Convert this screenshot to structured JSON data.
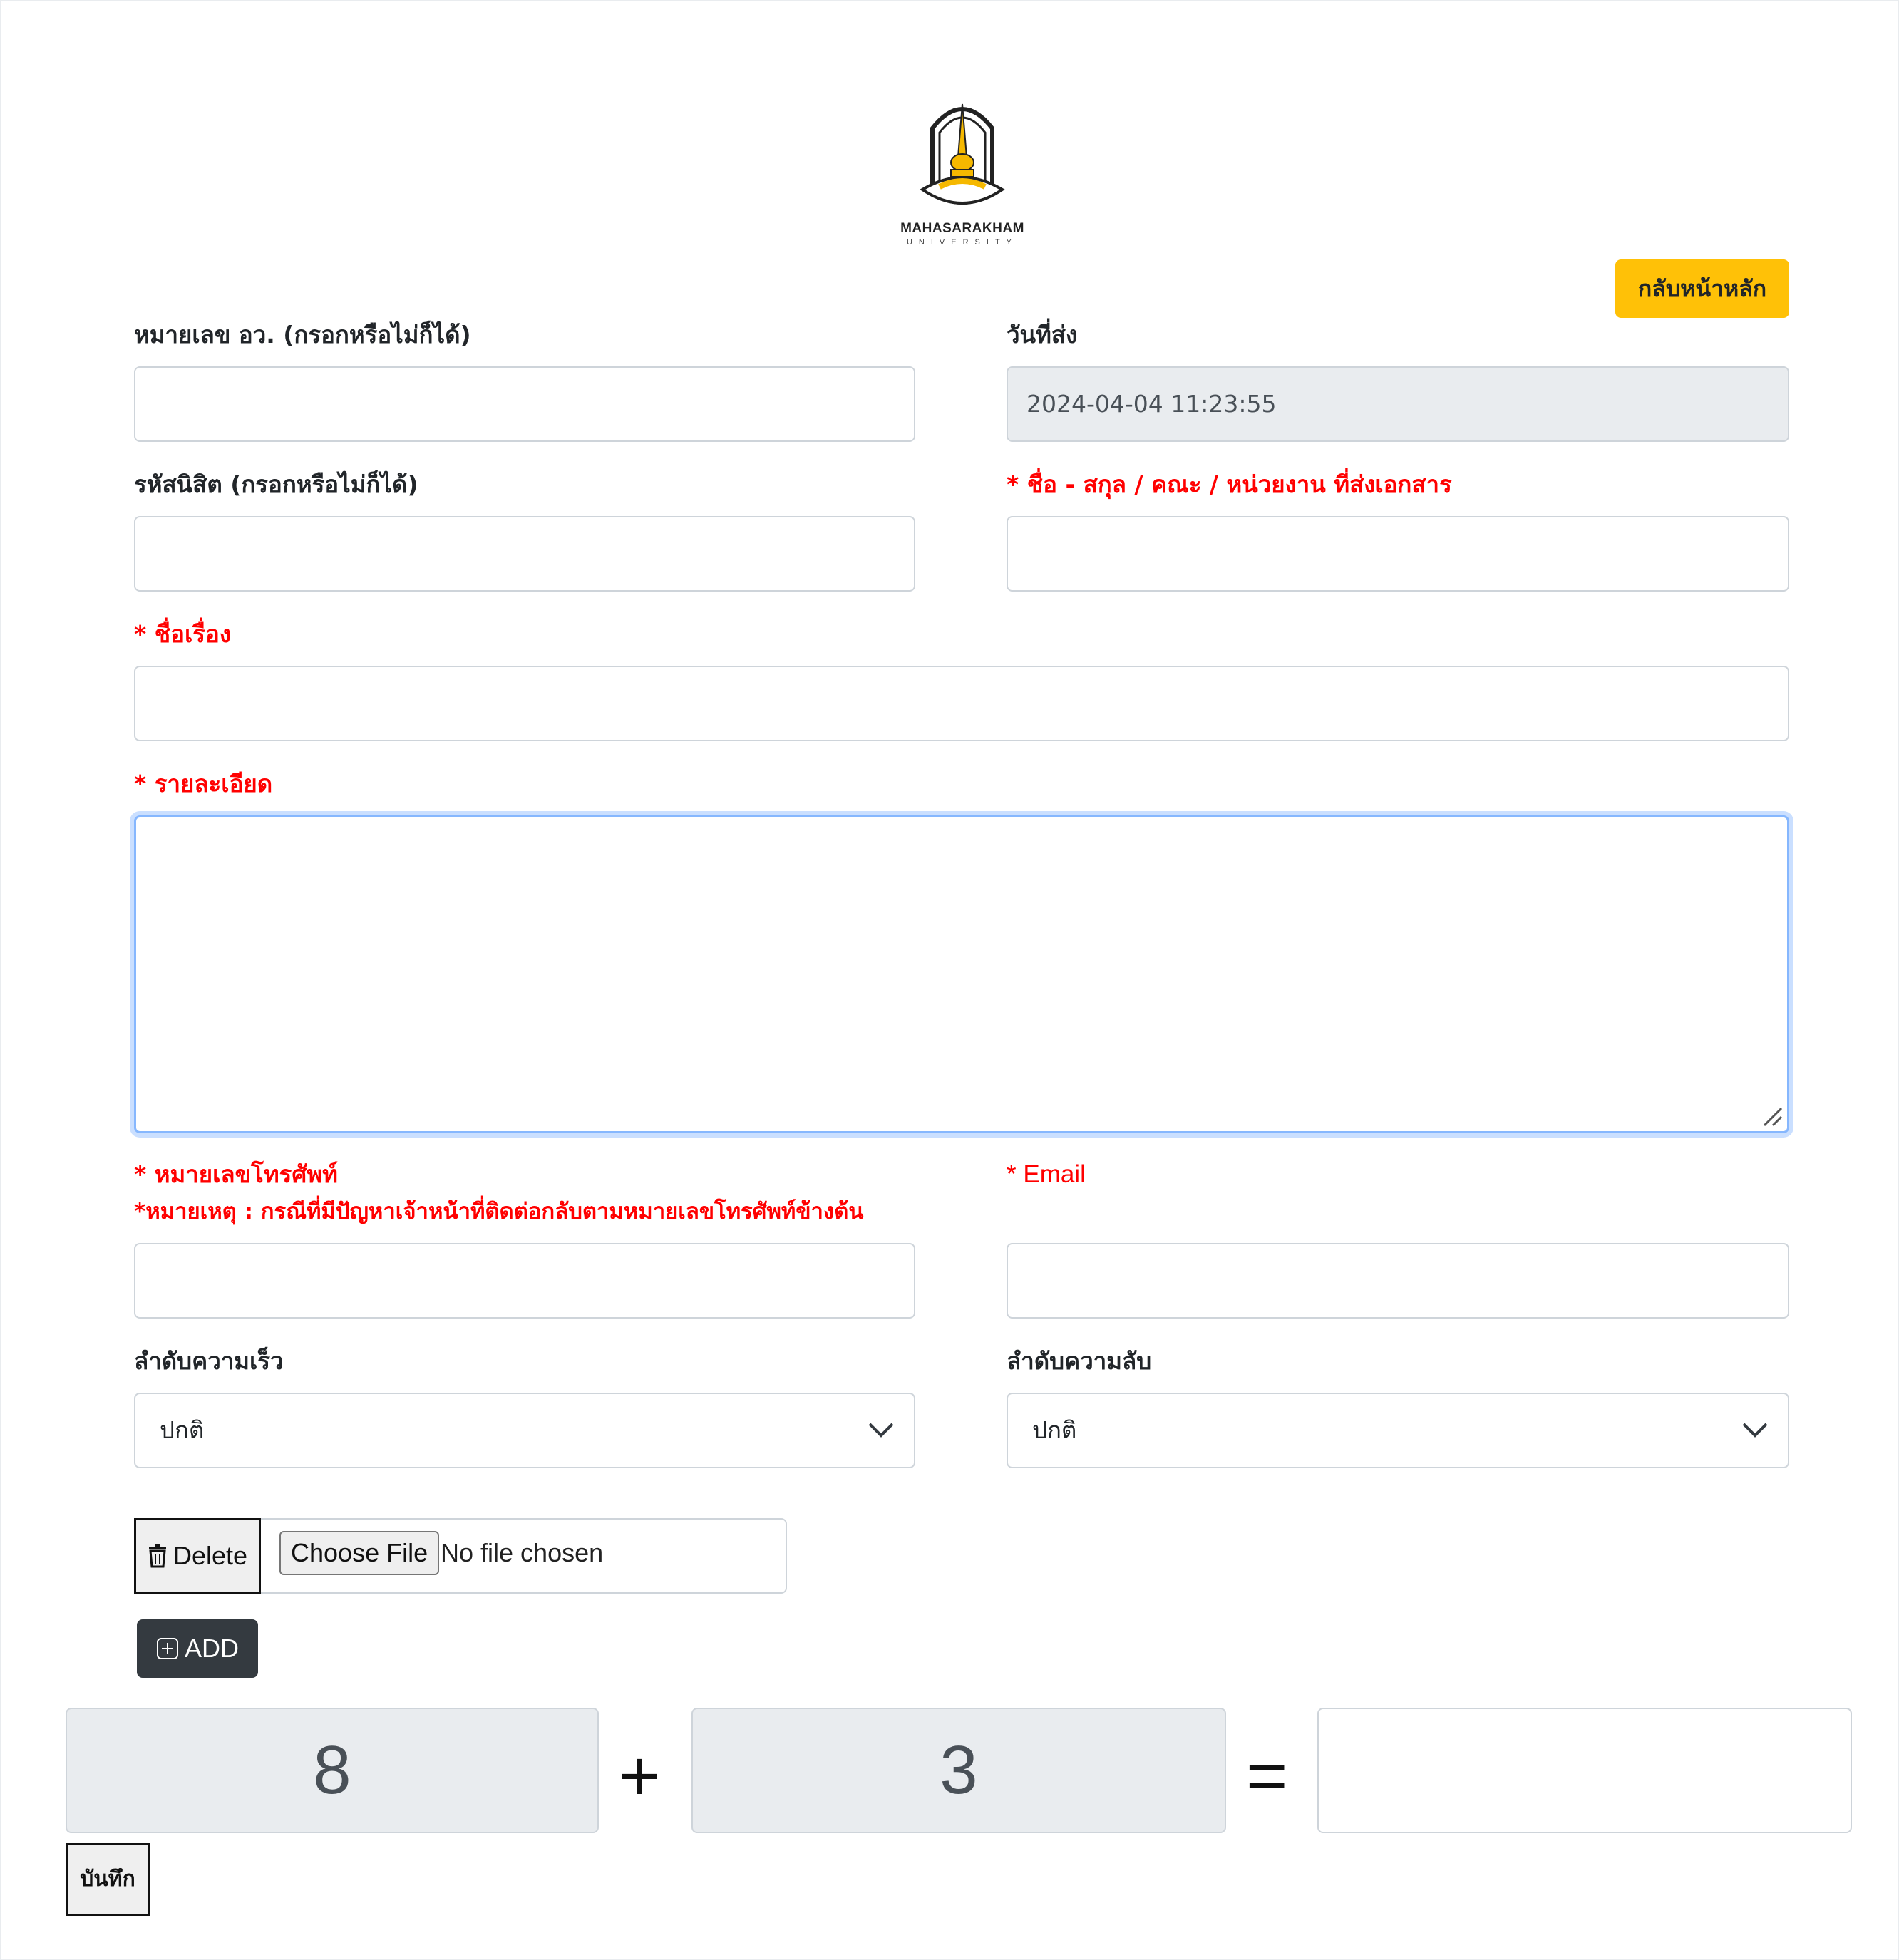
{
  "logo": {
    "text": "MAHASARAKHAM",
    "sub": "UNIVERSITY"
  },
  "back_button": {
    "label": "กลับหน้าหลัก"
  },
  "form": {
    "doc_number": {
      "label": "หมายเลข อว. (กรอกหรือไม่ก็ได้)",
      "value": ""
    },
    "send_date": {
      "label": "วันที่ส่ง",
      "value": "2024-04-04 11:23:55"
    },
    "student_id": {
      "label": "รหัสนิสิต (กรอกหรือไม่ก็ได้)",
      "value": ""
    },
    "sender_name": {
      "label": "* ชื่อ - สกุล / คณะ / หน่วยงาน ที่ส่งเอกสาร",
      "value": ""
    },
    "subject": {
      "label": "* ชื่อเรื่อง",
      "value": ""
    },
    "details": {
      "label": "* รายละเอียด",
      "value": ""
    },
    "phone": {
      "label": "* หมายเลขโทรศัพท์",
      "note": "*หมายเหตุ : กรณีที่มีปัญหาเจ้าหน้าที่ติดต่อกลับตามหมายเลขโทรศัพท์ข้างต้น",
      "value": ""
    },
    "email": {
      "label": "* Email",
      "value": ""
    },
    "urgency": {
      "label": "ลำดับความเร็ว",
      "selected": "ปกติ"
    },
    "confidentiality": {
      "label": "ลำดับความลับ",
      "selected": "ปกติ"
    }
  },
  "attachment": {
    "delete_label": "Delete",
    "choose_label": "Choose File",
    "status": "No file chosen",
    "add_label": "ADD"
  },
  "captcha": {
    "a": "8",
    "op": "+",
    "b": "3",
    "eq": "=",
    "answer": ""
  },
  "save_button": {
    "label": "บันทึก"
  },
  "colors": {
    "accent": "#ffc107",
    "required": "#ff0000",
    "dark_button": "#343a40",
    "focus": "#86b7fe"
  },
  "icons": [
    "university-logo",
    "resize-grip-icon",
    "chevron-down-icon",
    "trash-icon",
    "plus-square-icon"
  ]
}
